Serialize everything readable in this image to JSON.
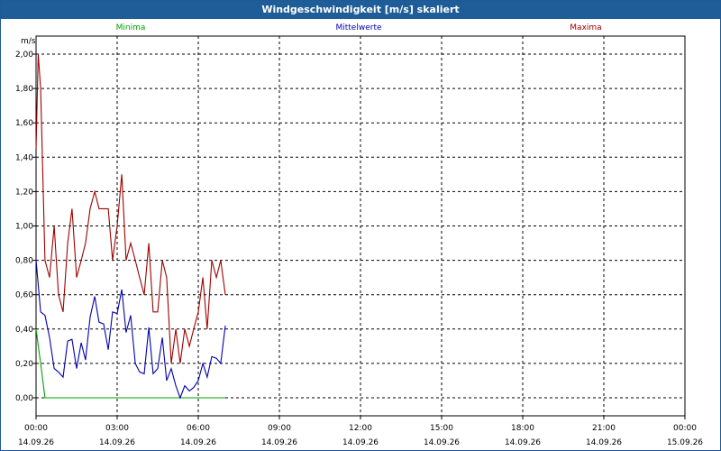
{
  "window": {
    "title": "Windgeschwindigkeit [m/s] skaliert"
  },
  "legend": [
    {
      "label": "Minima",
      "color": "#00a000"
    },
    {
      "label": "Mittelwerte",
      "color": "#0000b0"
    },
    {
      "label": "Maxima",
      "color": "#a00000"
    }
  ],
  "chart_data": {
    "type": "line",
    "ylabel": "m/s",
    "ylim": [
      0,
      2.1
    ],
    "yticks": [
      "0,00",
      "0,20",
      "0,40",
      "0,60",
      "0,80",
      "1,00",
      "1,20",
      "1,40",
      "1,60",
      "1,80",
      "2,00"
    ],
    "xlim_hours": [
      0,
      24
    ],
    "xticks": [
      {
        "time": "00:00",
        "date": "14.09.26"
      },
      {
        "time": "03:00",
        "date": "14.09.26"
      },
      {
        "time": "06:00",
        "date": "14.09.26"
      },
      {
        "time": "09:00",
        "date": "14.09.26"
      },
      {
        "time": "12:00",
        "date": "14.09.26"
      },
      {
        "time": "15:00",
        "date": "14.09.26"
      },
      {
        "time": "18:00",
        "date": "14.09.26"
      },
      {
        "time": "21:00",
        "date": "14.09.26"
      },
      {
        "time": "00:00",
        "date": "15.09.26"
      }
    ],
    "grid": true,
    "series": [
      {
        "name": "Minima",
        "color": "#00a000",
        "x": [
          0,
          0.17,
          0.33,
          7
        ],
        "y": [
          0.4,
          0.2,
          0.0,
          0.0
        ]
      },
      {
        "name": "Mittelwerte",
        "color": "#0000b0",
        "x": [
          0,
          0.17,
          0.33,
          0.5,
          0.67,
          0.83,
          1.0,
          1.17,
          1.33,
          1.5,
          1.67,
          1.83,
          2.0,
          2.17,
          2.33,
          2.5,
          2.67,
          2.83,
          3.0,
          3.17,
          3.33,
          3.5,
          3.67,
          3.83,
          4.0,
          4.17,
          4.33,
          4.5,
          4.67,
          4.83,
          5.0,
          5.17,
          5.33,
          5.5,
          5.67,
          5.83,
          6.0,
          6.17,
          6.33,
          6.5,
          6.67,
          6.83,
          7.0
        ],
        "y": [
          0.8,
          0.5,
          0.48,
          0.35,
          0.17,
          0.15,
          0.12,
          0.33,
          0.34,
          0.17,
          0.32,
          0.22,
          0.47,
          0.59,
          0.44,
          0.43,
          0.28,
          0.5,
          0.49,
          0.63,
          0.38,
          0.48,
          0.2,
          0.15,
          0.14,
          0.41,
          0.14,
          0.17,
          0.35,
          0.1,
          0.17,
          0.07,
          0.0,
          0.07,
          0.04,
          0.06,
          0.1,
          0.2,
          0.12,
          0.24,
          0.23,
          0.2,
          0.42
        ]
      },
      {
        "name": "Maxima",
        "color": "#a00000",
        "x": [
          0,
          0.08,
          0.17,
          0.33,
          0.5,
          0.67,
          0.83,
          1.0,
          1.17,
          1.33,
          1.5,
          1.67,
          1.83,
          2.0,
          2.17,
          2.33,
          2.5,
          2.67,
          2.83,
          3.0,
          3.17,
          3.33,
          3.5,
          3.67,
          3.83,
          4.0,
          4.17,
          4.33,
          4.5,
          4.67,
          4.83,
          5.0,
          5.17,
          5.33,
          5.5,
          5.67,
          5.83,
          6.0,
          6.17,
          6.33,
          6.5,
          6.67,
          6.83,
          7.0
        ],
        "y": [
          1.45,
          2.0,
          1.8,
          0.8,
          0.7,
          1.0,
          0.6,
          0.5,
          0.9,
          1.1,
          0.7,
          0.8,
          0.9,
          1.1,
          1.2,
          1.1,
          1.1,
          1.1,
          0.8,
          1.0,
          1.3,
          0.8,
          0.9,
          0.8,
          0.7,
          0.6,
          0.9,
          0.5,
          0.5,
          0.8,
          0.7,
          0.2,
          0.4,
          0.2,
          0.4,
          0.3,
          0.4,
          0.5,
          0.7,
          0.4,
          0.8,
          0.7,
          0.8,
          0.6
        ]
      }
    ]
  }
}
